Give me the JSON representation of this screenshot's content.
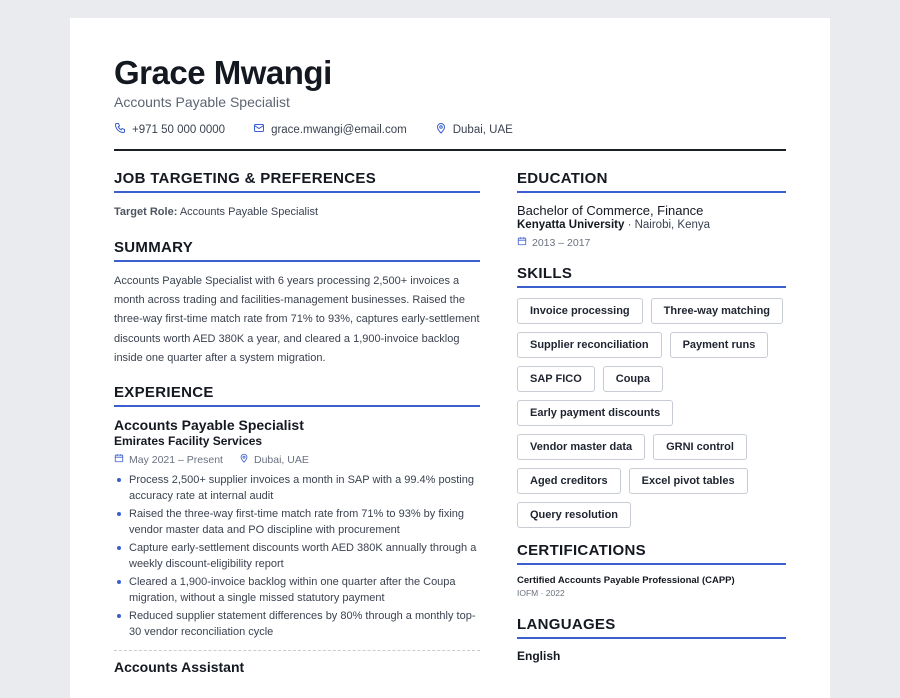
{
  "header": {
    "name": "Grace Mwangi",
    "title": "Accounts Payable Specialist",
    "phone": "+971 50 000 0000",
    "email": "grace.mwangi@email.com",
    "location": "Dubai, UAE"
  },
  "targeting": {
    "heading": "JOB TARGETING & PREFERENCES",
    "label": "Target Role:",
    "value": "Accounts Payable Specialist"
  },
  "summary": {
    "heading": "SUMMARY",
    "text": "Accounts Payable Specialist with 6 years processing 2,500+ invoices a month across trading and facilities-management businesses. Raised the three-way first-time match rate from 71% to 93%, captures early-settlement discounts worth AED 380K a year, and cleared a 1,900-invoice backlog inside one quarter after a system migration."
  },
  "experience": {
    "heading": "EXPERIENCE",
    "jobs": [
      {
        "title": "Accounts Payable Specialist",
        "company": "Emirates Facility Services",
        "dates": "May 2021 – Present",
        "location": "Dubai, UAE",
        "bullets": [
          "Process 2,500+ supplier invoices a month in SAP with a 99.4% posting accuracy rate at internal audit",
          "Raised the three-way first-time match rate from 71% to 93% by fixing vendor master data and PO discipline with procurement",
          "Capture early-settlement discounts worth AED 380K annually through a weekly discount-eligibility report",
          "Cleared a 1,900-invoice backlog within one quarter after the Coupa migration, without a single missed statutory payment",
          "Reduced supplier statement differences by 80% through a monthly top-30 vendor reconciliation cycle"
        ]
      }
    ],
    "next_title": "Accounts Assistant"
  },
  "education": {
    "heading": "EDUCATION",
    "degree": "Bachelor of Commerce, Finance",
    "school": "Kenyatta University",
    "location": " · Nairobi, Kenya",
    "years": "2013 – 2017"
  },
  "skills": {
    "heading": "SKILLS",
    "items": [
      "Invoice processing",
      "Three-way matching",
      "Supplier reconciliation",
      "Payment runs",
      "SAP FICO",
      "Coupa",
      "Early payment discounts",
      "Vendor master data",
      "GRNI control",
      "Aged creditors",
      "Excel pivot tables",
      "Query resolution"
    ]
  },
  "certifications": {
    "heading": "CERTIFICATIONS",
    "name": "Certified Accounts Payable Professional (CAPP)",
    "meta": "IOFM · 2022"
  },
  "languages": {
    "heading": "LANGUAGES",
    "first": "English"
  },
  "colors": {
    "accent": "#3b5fce",
    "text": "#1f2430",
    "muted": "#5d6573"
  }
}
